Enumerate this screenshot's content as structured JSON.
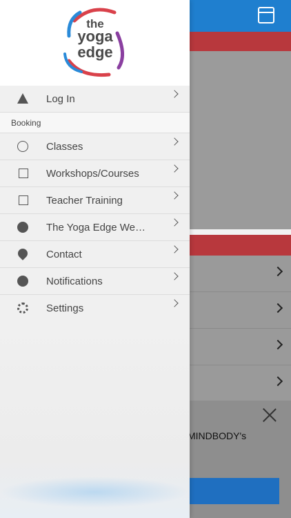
{
  "background": {
    "message_partial": "MINDBODY's",
    "colors": {
      "topbar": "#1f7fcf",
      "banner": "#b8383d",
      "button": "#1f6fc0"
    }
  },
  "logo": {
    "line1": "the",
    "line2": "yoga",
    "line3": "edge"
  },
  "menu": {
    "login": {
      "label": "Log In",
      "icon": "warning-icon"
    },
    "booking_section": "Booking",
    "items": [
      {
        "label": "Classes",
        "icon": "circle-icon"
      },
      {
        "label": "Workshops/Courses",
        "icon": "square-icon"
      },
      {
        "label": "Teacher Training",
        "icon": "square-icon"
      },
      {
        "label": "The Yoga Edge We…",
        "icon": "globe-icon"
      },
      {
        "label": "Contact",
        "icon": "location-pin-icon"
      },
      {
        "label": "Notifications",
        "icon": "chat-bubble-icon"
      },
      {
        "label": "Settings",
        "icon": "gear-icon"
      }
    ]
  }
}
